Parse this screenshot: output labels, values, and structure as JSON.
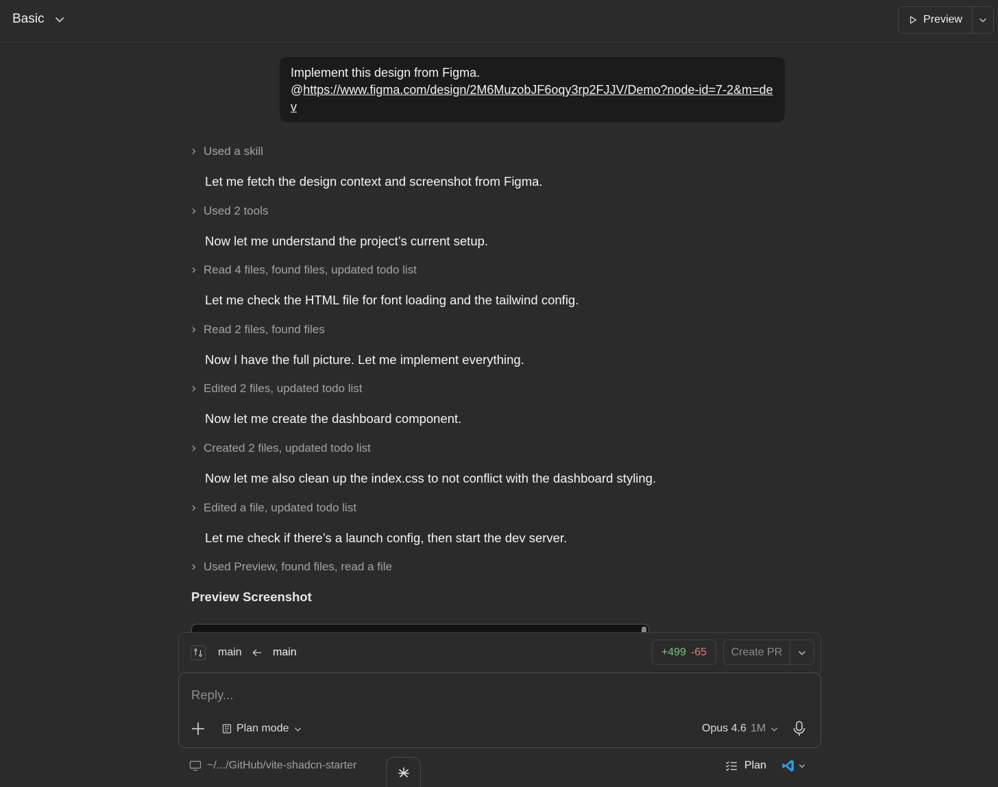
{
  "header": {
    "mode_label": "Basic",
    "preview_label": "Preview"
  },
  "user_message": {
    "prefix": "Implement this design from Figma.",
    "at": "@",
    "link_text": "https://www.figma.com/design/2M6MuzobJF6oqy3rp2FJJV/Demo?node-id=7-2&m=dev"
  },
  "transcript": [
    {
      "kind": "step",
      "text": "Used a skill"
    },
    {
      "kind": "text",
      "text": "Let me fetch the design context and screenshot from Figma."
    },
    {
      "kind": "step",
      "text": "Used 2 tools"
    },
    {
      "kind": "text",
      "text": "Now let me understand the project’s current setup."
    },
    {
      "kind": "step",
      "text": "Read 4 files, found files, updated todo list"
    },
    {
      "kind": "text",
      "text": "Let me check the HTML file for font loading and the tailwind config."
    },
    {
      "kind": "step",
      "text": "Read 2 files, found files"
    },
    {
      "kind": "text",
      "text": "Now I have the full picture. Let me implement everything."
    },
    {
      "kind": "step",
      "text": "Edited 2 files, updated todo list"
    },
    {
      "kind": "text",
      "text": "Now let me create the dashboard component."
    },
    {
      "kind": "step",
      "text": "Created 2 files, updated todo list"
    },
    {
      "kind": "text",
      "text": "Now let me also clean up the index.css to not conflict with the dashboard styling."
    },
    {
      "kind": "step",
      "text": "Edited a file, updated todo list"
    },
    {
      "kind": "text",
      "text": "Let me check if there’s a launch config, then start the dev server."
    },
    {
      "kind": "step",
      "text": "Used Preview, found files, read a file"
    }
  ],
  "preview_section": {
    "heading": "Preview Screenshot"
  },
  "branch_bar": {
    "from_branch": "main",
    "to_branch": "main",
    "additions": "+499",
    "deletions": "-65",
    "create_pr_label": "Create PR"
  },
  "composer": {
    "placeholder": "Reply...",
    "plan_mode_label": "Plan mode",
    "model_name": "Opus 4.6",
    "model_context": "1M"
  },
  "footer": {
    "path": "~/.../GitHub/vite-shadcn-starter",
    "plan_label": "Plan"
  },
  "colors": {
    "background": "#2b2b2b",
    "user_bubble": "#1b1b1b",
    "additions": "#7bc67b",
    "deletions": "#e07b7b",
    "vscode_blue": "#2f9be4"
  }
}
